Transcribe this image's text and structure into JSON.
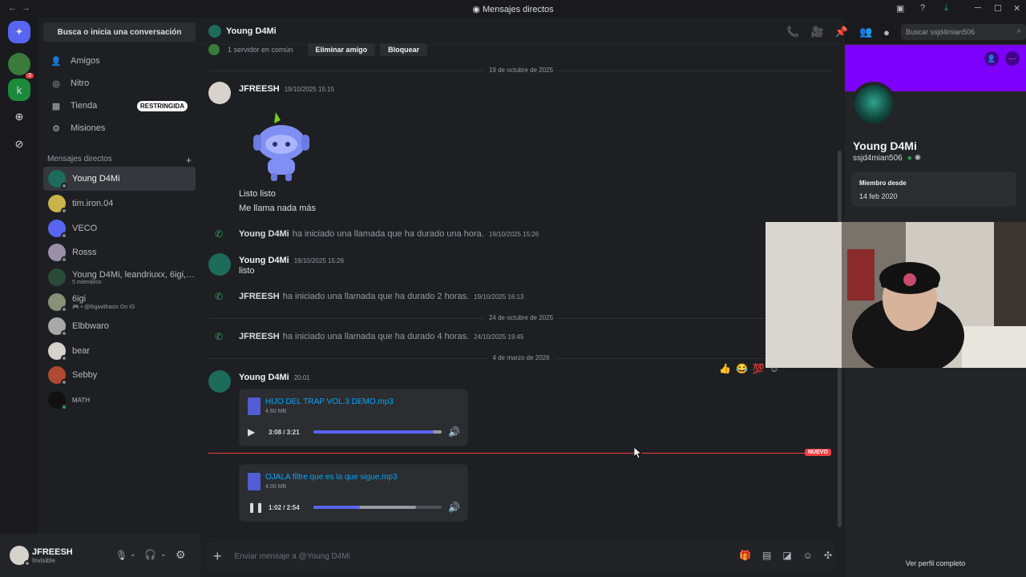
{
  "window": {
    "title": "Mensajes directos",
    "nav_back": "←",
    "nav_fwd": "→"
  },
  "sidebar": {
    "search_label": "Busca o inicia una conversación",
    "nav": [
      {
        "label": "Amigos",
        "icon": "friends-icon"
      },
      {
        "label": "Nitro",
        "icon": "nitro-icon"
      },
      {
        "label": "Tienda",
        "icon": "shop-icon",
        "badge": "RESTRINGIDA"
      },
      {
        "label": "Misiones",
        "icon": "quests-icon"
      }
    ],
    "dm_header": "Mensajes directos",
    "dms": [
      {
        "name": "Young D4Mi",
        "color": "#1d6b5a"
      },
      {
        "name": "tim.iron.04",
        "color": "#c9b24a"
      },
      {
        "name": "VECO",
        "color": "#5865f2"
      },
      {
        "name": "Rosss",
        "color": "#9a8fa8"
      },
      {
        "name": "Young D4Mi, leandriuxx, 6igi, w...",
        "sub": "5 miembros",
        "color": "#2a4a3a"
      },
      {
        "name": "6igi",
        "sub": "🎮 • @6igiwithasix On IG",
        "color": "#8a8f7a"
      },
      {
        "name": "Elbbwaro",
        "color": "#a8a8a8"
      },
      {
        "name": "bear",
        "color": "#d7d2cc"
      },
      {
        "name": "Sebby",
        "color": "#b04a30"
      },
      {
        "name": "MATH",
        "color": "#111111"
      }
    ],
    "server_badge": "3"
  },
  "user": {
    "name": "JFREESH",
    "status": "Invisible"
  },
  "chat": {
    "title": "Young D4Mi",
    "search_placeholder": "Buscar ssjd4mian506",
    "mutual": "1 servidor en común",
    "remove_friend": "Eliminar amigo",
    "block": "Bloquear",
    "date1": "19 de octubre de 2025",
    "msg1": {
      "user": "JFREESH",
      "time": "19/10/2025 15:15",
      "line1": "Listo listo",
      "line2": "Me llama nada más"
    },
    "call1": {
      "user": "Young D4Mi",
      "text": "ha iniciado una llamada que ha durado una hora.",
      "time": "19/10/2025 15:26"
    },
    "msg2": {
      "user": "Young D4Mi",
      "time": "19/10/2025 15:26",
      "text": "listo"
    },
    "call2": {
      "user": "JFREESH",
      "text": "ha iniciado una llamada que ha durado 2 horas.",
      "time": "19/10/2025 16:13"
    },
    "date2": "24 de octubre de 2025",
    "call3": {
      "user": "JFREESH",
      "text": "ha iniciado una llamada que ha durado 4 horas.",
      "time": "24/10/2025 19:45"
    },
    "date3": "4 de marzo de 2026",
    "msg3": {
      "user": "Young D4Mi",
      "time": "20:01"
    },
    "audio1": {
      "name": "HIJO DEL TRAP VOL.3 DEMO.mp3",
      "size": "4.60 MB",
      "time": "3:08 / 3:21",
      "progress": 0.94,
      "buffered": 1.0
    },
    "new_label": "NUEVO",
    "audio2": {
      "name": "OJALA filtre que es la que sigue.mp3",
      "size": "4.00 MB",
      "time": "1:02 / 2:54",
      "progress": 0.36,
      "buffered": 0.8
    },
    "composer_placeholder": "Enviar mensaje a @Young D4Mi",
    "reactions": [
      "👍",
      "😂",
      "💯"
    ]
  },
  "profile": {
    "name": "Young D4Mi",
    "username": "ssjd4mian506",
    "member_label": "Miembro desde",
    "member_date": "14 feb 2020",
    "full_profile": "Ver perfil completo"
  }
}
